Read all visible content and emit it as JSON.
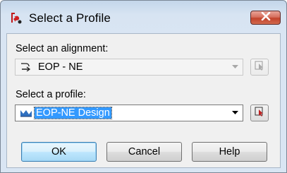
{
  "window": {
    "title": "Select a Profile",
    "close_label": "Close"
  },
  "alignment": {
    "label": "Select an alignment:",
    "value": "EOP - NE",
    "icon": "alignment-icon",
    "enabled": false
  },
  "profile": {
    "label": "Select a profile:",
    "value": "EOP-NE Design",
    "icon": "profile-icon",
    "enabled": true
  },
  "buttons": {
    "ok": "OK",
    "cancel": "Cancel",
    "help": "Help"
  },
  "colors": {
    "selection": "#3399ff",
    "close_button": "#c2432c",
    "default_button": "#bee6fd"
  }
}
